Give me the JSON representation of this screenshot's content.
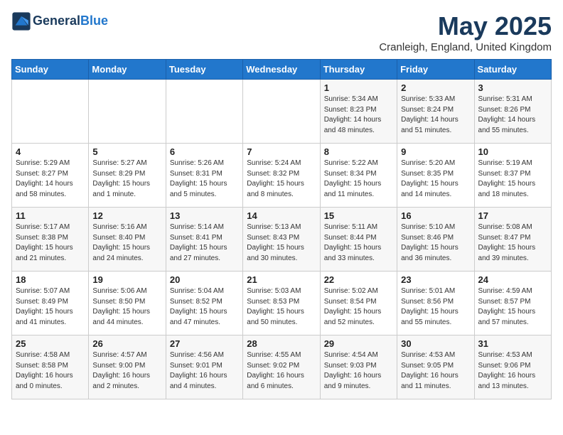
{
  "header": {
    "logo_line1": "General",
    "logo_line2": "Blue",
    "month_title": "May 2025",
    "location": "Cranleigh, England, United Kingdom"
  },
  "weekdays": [
    "Sunday",
    "Monday",
    "Tuesday",
    "Wednesday",
    "Thursday",
    "Friday",
    "Saturday"
  ],
  "weeks": [
    [
      {
        "day": "",
        "info": ""
      },
      {
        "day": "",
        "info": ""
      },
      {
        "day": "",
        "info": ""
      },
      {
        "day": "",
        "info": ""
      },
      {
        "day": "1",
        "info": "Sunrise: 5:34 AM\nSunset: 8:23 PM\nDaylight: 14 hours\nand 48 minutes."
      },
      {
        "day": "2",
        "info": "Sunrise: 5:33 AM\nSunset: 8:24 PM\nDaylight: 14 hours\nand 51 minutes."
      },
      {
        "day": "3",
        "info": "Sunrise: 5:31 AM\nSunset: 8:26 PM\nDaylight: 14 hours\nand 55 minutes."
      }
    ],
    [
      {
        "day": "4",
        "info": "Sunrise: 5:29 AM\nSunset: 8:27 PM\nDaylight: 14 hours\nand 58 minutes."
      },
      {
        "day": "5",
        "info": "Sunrise: 5:27 AM\nSunset: 8:29 PM\nDaylight: 15 hours\nand 1 minute."
      },
      {
        "day": "6",
        "info": "Sunrise: 5:26 AM\nSunset: 8:31 PM\nDaylight: 15 hours\nand 5 minutes."
      },
      {
        "day": "7",
        "info": "Sunrise: 5:24 AM\nSunset: 8:32 PM\nDaylight: 15 hours\nand 8 minutes."
      },
      {
        "day": "8",
        "info": "Sunrise: 5:22 AM\nSunset: 8:34 PM\nDaylight: 15 hours\nand 11 minutes."
      },
      {
        "day": "9",
        "info": "Sunrise: 5:20 AM\nSunset: 8:35 PM\nDaylight: 15 hours\nand 14 minutes."
      },
      {
        "day": "10",
        "info": "Sunrise: 5:19 AM\nSunset: 8:37 PM\nDaylight: 15 hours\nand 18 minutes."
      }
    ],
    [
      {
        "day": "11",
        "info": "Sunrise: 5:17 AM\nSunset: 8:38 PM\nDaylight: 15 hours\nand 21 minutes."
      },
      {
        "day": "12",
        "info": "Sunrise: 5:16 AM\nSunset: 8:40 PM\nDaylight: 15 hours\nand 24 minutes."
      },
      {
        "day": "13",
        "info": "Sunrise: 5:14 AM\nSunset: 8:41 PM\nDaylight: 15 hours\nand 27 minutes."
      },
      {
        "day": "14",
        "info": "Sunrise: 5:13 AM\nSunset: 8:43 PM\nDaylight: 15 hours\nand 30 minutes."
      },
      {
        "day": "15",
        "info": "Sunrise: 5:11 AM\nSunset: 8:44 PM\nDaylight: 15 hours\nand 33 minutes."
      },
      {
        "day": "16",
        "info": "Sunrise: 5:10 AM\nSunset: 8:46 PM\nDaylight: 15 hours\nand 36 minutes."
      },
      {
        "day": "17",
        "info": "Sunrise: 5:08 AM\nSunset: 8:47 PM\nDaylight: 15 hours\nand 39 minutes."
      }
    ],
    [
      {
        "day": "18",
        "info": "Sunrise: 5:07 AM\nSunset: 8:49 PM\nDaylight: 15 hours\nand 41 minutes."
      },
      {
        "day": "19",
        "info": "Sunrise: 5:06 AM\nSunset: 8:50 PM\nDaylight: 15 hours\nand 44 minutes."
      },
      {
        "day": "20",
        "info": "Sunrise: 5:04 AM\nSunset: 8:52 PM\nDaylight: 15 hours\nand 47 minutes."
      },
      {
        "day": "21",
        "info": "Sunrise: 5:03 AM\nSunset: 8:53 PM\nDaylight: 15 hours\nand 50 minutes."
      },
      {
        "day": "22",
        "info": "Sunrise: 5:02 AM\nSunset: 8:54 PM\nDaylight: 15 hours\nand 52 minutes."
      },
      {
        "day": "23",
        "info": "Sunrise: 5:01 AM\nSunset: 8:56 PM\nDaylight: 15 hours\nand 55 minutes."
      },
      {
        "day": "24",
        "info": "Sunrise: 4:59 AM\nSunset: 8:57 PM\nDaylight: 15 hours\nand 57 minutes."
      }
    ],
    [
      {
        "day": "25",
        "info": "Sunrise: 4:58 AM\nSunset: 8:58 PM\nDaylight: 16 hours\nand 0 minutes."
      },
      {
        "day": "26",
        "info": "Sunrise: 4:57 AM\nSunset: 9:00 PM\nDaylight: 16 hours\nand 2 minutes."
      },
      {
        "day": "27",
        "info": "Sunrise: 4:56 AM\nSunset: 9:01 PM\nDaylight: 16 hours\nand 4 minutes."
      },
      {
        "day": "28",
        "info": "Sunrise: 4:55 AM\nSunset: 9:02 PM\nDaylight: 16 hours\nand 6 minutes."
      },
      {
        "day": "29",
        "info": "Sunrise: 4:54 AM\nSunset: 9:03 PM\nDaylight: 16 hours\nand 9 minutes."
      },
      {
        "day": "30",
        "info": "Sunrise: 4:53 AM\nSunset: 9:05 PM\nDaylight: 16 hours\nand 11 minutes."
      },
      {
        "day": "31",
        "info": "Sunrise: 4:53 AM\nSunset: 9:06 PM\nDaylight: 16 hours\nand 13 minutes."
      }
    ]
  ]
}
